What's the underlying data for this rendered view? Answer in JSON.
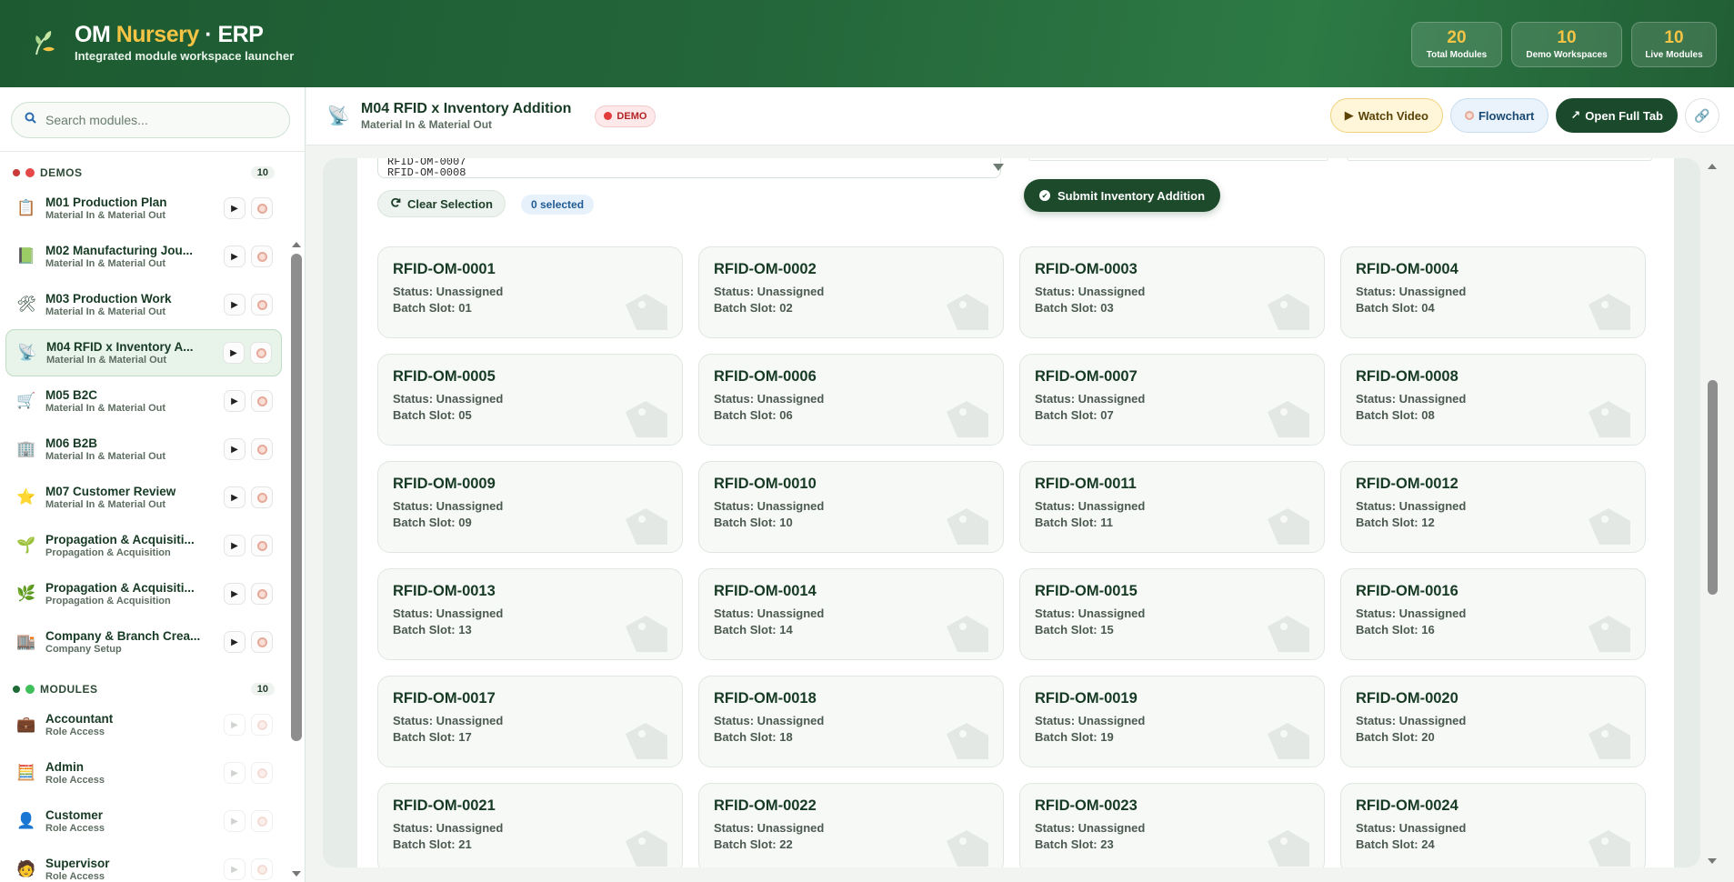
{
  "brand": {
    "name_main": "OM",
    "name_accent": "Nursery",
    "name_tail": "· ERP",
    "subtitle": "Integrated module workspace launcher"
  },
  "stats": [
    {
      "value": "20",
      "label": "Total Modules"
    },
    {
      "value": "10",
      "label": "Demo Workspaces"
    },
    {
      "value": "10",
      "label": "Live Modules"
    }
  ],
  "search": {
    "placeholder": "Search modules...",
    "value": ""
  },
  "sections": {
    "demos": {
      "label": "DEMOS",
      "count": "10"
    },
    "modules": {
      "label": "MODULES",
      "count": "10"
    }
  },
  "demo_items": [
    {
      "title": "M01 Production Plan",
      "subtitle": "Material In & Material Out",
      "icon": "clipboard-icon"
    },
    {
      "title": "M02 Manufacturing Jou...",
      "subtitle": "Material In & Material Out",
      "icon": "green-book-icon"
    },
    {
      "title": "M03 Production Work",
      "subtitle": "Material In & Material Out",
      "icon": "tools-icon"
    },
    {
      "title": "M04 RFID x Inventory A...",
      "subtitle": "Material In & Material Out",
      "icon": "satellite-dish-icon"
    },
    {
      "title": "M05 B2C",
      "subtitle": "Material In & Material Out",
      "icon": "shopping-cart-icon"
    },
    {
      "title": "M06 B2B",
      "subtitle": "Material In & Material Out",
      "icon": "office-building-icon"
    },
    {
      "title": "M07 Customer Review",
      "subtitle": "Material In & Material Out",
      "icon": "star-icon"
    },
    {
      "title": "Propagation & Acquisiti...",
      "subtitle": "Propagation & Acquisition",
      "icon": "seedling-icon"
    },
    {
      "title": "Propagation & Acquisiti...",
      "subtitle": "Propagation & Acquisition",
      "icon": "herb-icon"
    },
    {
      "title": "Company & Branch Crea...",
      "subtitle": "Company Setup",
      "icon": "building-icon"
    }
  ],
  "module_items": [
    {
      "title": "Accountant",
      "subtitle": "Role Access",
      "icon": "briefcase-icon"
    },
    {
      "title": "Admin",
      "subtitle": "Role Access",
      "icon": "admin-panel-icon"
    },
    {
      "title": "Customer",
      "subtitle": "Role Access",
      "icon": "person-icon"
    },
    {
      "title": "Supervisor",
      "subtitle": "Role Access",
      "icon": "supervisor-icon"
    }
  ],
  "workspace": {
    "title": "M04 RFID x Inventory Addition",
    "subtitle": "Material In & Material Out",
    "badge": "DEMO",
    "actions": {
      "video": "Watch Video",
      "flowchart": "Flowchart",
      "open_full": "Open Full Tab"
    }
  },
  "form": {
    "visible_options": [
      "RFID-OM-0007",
      "RFID-OM-0008"
    ],
    "clear_label": "Clear Selection",
    "selected_label": "0 selected",
    "submit_label": "Submit Inventory Addition"
  },
  "cards": [
    {
      "id": "RFID-OM-0001",
      "status": "Status: Unassigned",
      "slot": "Batch Slot: 01"
    },
    {
      "id": "RFID-OM-0002",
      "status": "Status: Unassigned",
      "slot": "Batch Slot: 02"
    },
    {
      "id": "RFID-OM-0003",
      "status": "Status: Unassigned",
      "slot": "Batch Slot: 03"
    },
    {
      "id": "RFID-OM-0004",
      "status": "Status: Unassigned",
      "slot": "Batch Slot: 04"
    },
    {
      "id": "RFID-OM-0005",
      "status": "Status: Unassigned",
      "slot": "Batch Slot: 05"
    },
    {
      "id": "RFID-OM-0006",
      "status": "Status: Unassigned",
      "slot": "Batch Slot: 06"
    },
    {
      "id": "RFID-OM-0007",
      "status": "Status: Unassigned",
      "slot": "Batch Slot: 07"
    },
    {
      "id": "RFID-OM-0008",
      "status": "Status: Unassigned",
      "slot": "Batch Slot: 08"
    },
    {
      "id": "RFID-OM-0009",
      "status": "Status: Unassigned",
      "slot": "Batch Slot: 09"
    },
    {
      "id": "RFID-OM-0010",
      "status": "Status: Unassigned",
      "slot": "Batch Slot: 10"
    },
    {
      "id": "RFID-OM-0011",
      "status": "Status: Unassigned",
      "slot": "Batch Slot: 11"
    },
    {
      "id": "RFID-OM-0012",
      "status": "Status: Unassigned",
      "slot": "Batch Slot: 12"
    },
    {
      "id": "RFID-OM-0013",
      "status": "Status: Unassigned",
      "slot": "Batch Slot: 13"
    },
    {
      "id": "RFID-OM-0014",
      "status": "Status: Unassigned",
      "slot": "Batch Slot: 14"
    },
    {
      "id": "RFID-OM-0015",
      "status": "Status: Unassigned",
      "slot": "Batch Slot: 15"
    },
    {
      "id": "RFID-OM-0016",
      "status": "Status: Unassigned",
      "slot": "Batch Slot: 16"
    },
    {
      "id": "RFID-OM-0017",
      "status": "Status: Unassigned",
      "slot": "Batch Slot: 17"
    },
    {
      "id": "RFID-OM-0018",
      "status": "Status: Unassigned",
      "slot": "Batch Slot: 18"
    },
    {
      "id": "RFID-OM-0019",
      "status": "Status: Unassigned",
      "slot": "Batch Slot: 19"
    },
    {
      "id": "RFID-OM-0020",
      "status": "Status: Unassigned",
      "slot": "Batch Slot: 20"
    },
    {
      "id": "RFID-OM-0021",
      "status": "Status: Unassigned",
      "slot": "Batch Slot: 21"
    },
    {
      "id": "RFID-OM-0022",
      "status": "Status: Unassigned",
      "slot": "Batch Slot: 22"
    },
    {
      "id": "RFID-OM-0023",
      "status": "Status: Unassigned",
      "slot": "Batch Slot: 23"
    },
    {
      "id": "RFID-OM-0024",
      "status": "Status: Unassigned",
      "slot": "Batch Slot: 24"
    }
  ],
  "colors": {
    "header_green": "#24673a",
    "accent_gold": "#f6c445",
    "dark_green": "#1a4a2b",
    "demo_red": "#e23b3b"
  }
}
